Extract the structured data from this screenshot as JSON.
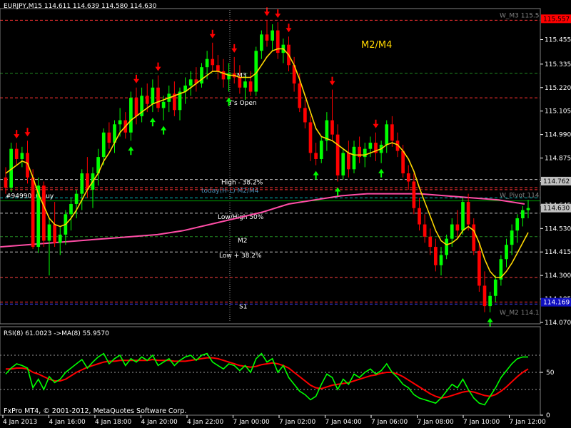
{
  "header": {
    "symbol_line": "EURJPY,M15  114.611 114.639 114.580 114.630",
    "rsi_line": "RSI(8) 61.0023  ->MA(8) 55.9570",
    "copyright": "FxPro MT4, © 2001-2012, MetaQuotes Software Corp."
  },
  "colors": {
    "background": "#000000",
    "bull": "#00ff00",
    "bear": "#ff0000",
    "ma_fast": "#ffd700",
    "ma_slow": "#ff4da6",
    "rsi": "#00ff00",
    "rsi_ma": "#ff0000",
    "axis_text": "#ffffff",
    "grid_dash": "#ff3333",
    "level_green": "#228b22",
    "level_white": "#c0c0c0",
    "current_price_tag": "#c0c0c0",
    "tag_red": "#ff0000",
    "tag_blue": "#1010c0"
  },
  "annotation": "M2/M4",
  "chart_data": [
    {
      "type": "candlestick",
      "title": "EURJPY,M15",
      "ylim": [
        114.07,
        115.6
      ],
      "yticks": [
        "115.455",
        "115.335",
        "115.220",
        "115.105",
        "114.990",
        "114.875",
        "114.760",
        "114.645",
        "114.530",
        "114.415",
        "114.300",
        "114.185",
        "114.070"
      ],
      "xticks": [
        "4 Jan 2013",
        "4 Jan 16:00",
        "4 Jan 18:00",
        "4 Jan 20:00",
        "4 Jan 22:00",
        "7 Jan 00:00",
        "7 Jan 02:00",
        "7 Jan 04:00",
        "7 Jan 06:00",
        "7 Jan 08:00",
        "7 Jan 10:00",
        "7 Jan 12:00"
      ],
      "ohlc": [
        [
          114.78,
          114.83,
          114.7,
          114.73
        ],
        [
          114.73,
          114.95,
          114.71,
          114.92
        ],
        [
          114.92,
          114.95,
          114.84,
          114.87
        ],
        [
          114.87,
          114.93,
          114.83,
          114.9
        ],
        [
          114.9,
          114.96,
          114.75,
          114.78
        ],
        [
          114.78,
          114.82,
          114.43,
          114.44
        ],
        [
          114.44,
          114.78,
          114.41,
          114.74
        ],
        [
          114.74,
          114.76,
          114.44,
          114.47
        ],
        [
          114.47,
          114.58,
          114.3,
          114.55
        ],
        [
          114.55,
          114.66,
          114.44,
          114.46
        ],
        [
          114.46,
          114.54,
          114.4,
          114.5
        ],
        [
          114.5,
          114.62,
          114.45,
          114.6
        ],
        [
          114.6,
          114.68,
          114.52,
          114.65
        ],
        [
          114.65,
          114.72,
          114.58,
          114.7
        ],
        [
          114.7,
          114.82,
          114.62,
          114.8
        ],
        [
          114.8,
          114.88,
          114.68,
          114.72
        ],
        [
          114.72,
          114.83,
          114.63,
          114.8
        ],
        [
          114.8,
          114.92,
          114.74,
          114.88
        ],
        [
          114.88,
          115.02,
          114.84,
          115.0
        ],
        [
          115.0,
          115.05,
          114.92,
          114.95
        ],
        [
          114.95,
          115.06,
          114.9,
          115.04
        ],
        [
          115.04,
          115.12,
          114.98,
          115.06
        ],
        [
          115.06,
          115.1,
          114.97,
          115.0
        ],
        [
          115.0,
          115.2,
          114.96,
          115.17
        ],
        [
          115.17,
          115.22,
          115.04,
          115.08
        ],
        [
          115.08,
          115.22,
          115.05,
          115.18
        ],
        [
          115.18,
          115.24,
          115.1,
          115.14
        ],
        [
          115.14,
          115.26,
          115.1,
          115.22
        ],
        [
          115.22,
          115.28,
          115.1,
          115.12
        ],
        [
          115.12,
          115.18,
          115.06,
          115.15
        ],
        [
          115.15,
          115.23,
          115.1,
          115.19
        ],
        [
          115.19,
          115.25,
          115.08,
          115.11
        ],
        [
          115.11,
          115.22,
          115.06,
          115.2
        ],
        [
          115.2,
          115.27,
          115.14,
          115.23
        ],
        [
          115.23,
          115.3,
          115.18,
          115.26
        ],
        [
          115.26,
          115.32,
          115.2,
          115.24
        ],
        [
          115.24,
          115.34,
          115.22,
          115.32
        ],
        [
          115.32,
          115.4,
          115.26,
          115.36
        ],
        [
          115.36,
          115.44,
          115.3,
          115.33
        ],
        [
          115.33,
          115.38,
          115.26,
          115.3
        ],
        [
          115.3,
          115.36,
          115.22,
          115.26
        ],
        [
          115.26,
          115.34,
          115.2,
          115.29
        ],
        [
          115.29,
          115.37,
          115.24,
          115.27
        ],
        [
          115.27,
          115.33,
          115.19,
          115.22
        ],
        [
          115.22,
          115.28,
          115.16,
          115.25
        ],
        [
          115.25,
          115.3,
          115.18,
          115.2
        ],
        [
          115.2,
          115.42,
          115.18,
          115.4
        ],
        [
          115.4,
          115.5,
          115.36,
          115.48
        ],
        [
          115.48,
          115.55,
          115.42,
          115.45
        ],
        [
          115.45,
          115.53,
          115.4,
          115.5
        ],
        [
          115.5,
          115.54,
          115.36,
          115.39
        ],
        [
          115.39,
          115.46,
          115.34,
          115.43
        ],
        [
          115.43,
          115.47,
          115.3,
          115.33
        ],
        [
          115.33,
          115.37,
          115.2,
          115.24
        ],
        [
          115.24,
          115.29,
          115.1,
          115.12
        ],
        [
          115.12,
          115.16,
          115.02,
          115.05
        ],
        [
          115.05,
          115.08,
          114.86,
          114.9
        ],
        [
          114.9,
          114.95,
          114.84,
          114.87
        ],
        [
          114.87,
          114.98,
          114.85,
          114.96
        ],
        [
          114.96,
          115.1,
          114.91,
          115.06
        ],
        [
          115.06,
          115.21,
          114.96,
          114.99
        ],
        [
          114.99,
          115.04,
          114.76,
          114.79
        ],
        [
          114.79,
          114.92,
          114.77,
          114.9
        ],
        [
          114.9,
          114.96,
          114.78,
          114.82
        ],
        [
          114.82,
          114.96,
          114.8,
          114.93
        ],
        [
          114.93,
          114.98,
          114.85,
          114.88
        ],
        [
          114.88,
          114.95,
          114.83,
          114.92
        ],
        [
          114.92,
          114.98,
          114.88,
          114.95
        ],
        [
          114.95,
          115.0,
          114.86,
          114.9
        ],
        [
          114.9,
          114.96,
          114.85,
          114.94
        ],
        [
          114.94,
          115.06,
          114.9,
          115.04
        ],
        [
          115.04,
          115.08,
          114.93,
          114.96
        ],
        [
          114.96,
          115.0,
          114.88,
          114.91
        ],
        [
          114.91,
          114.94,
          114.78,
          114.8
        ],
        [
          114.8,
          114.84,
          114.72,
          114.76
        ],
        [
          114.76,
          114.8,
          114.6,
          114.63
        ],
        [
          114.63,
          114.68,
          114.52,
          114.55
        ],
        [
          114.55,
          114.6,
          114.46,
          114.49
        ],
        [
          114.49,
          114.53,
          114.4,
          114.44
        ],
        [
          114.44,
          114.48,
          114.32,
          114.35
        ],
        [
          114.35,
          114.44,
          114.3,
          114.4
        ],
        [
          114.4,
          114.5,
          114.38,
          114.48
        ],
        [
          114.48,
          114.58,
          114.44,
          114.55
        ],
        [
          114.55,
          114.62,
          114.48,
          114.52
        ],
        [
          114.52,
          114.68,
          114.5,
          114.66
        ],
        [
          114.66,
          114.7,
          114.52,
          114.55
        ],
        [
          114.55,
          114.58,
          114.4,
          114.42
        ],
        [
          114.42,
          114.46,
          114.22,
          114.25
        ],
        [
          114.25,
          114.32,
          114.12,
          114.15
        ],
        [
          114.15,
          114.22,
          114.12,
          114.2
        ],
        [
          114.2,
          114.3,
          114.17,
          114.28
        ],
        [
          114.28,
          114.4,
          114.25,
          114.38
        ],
        [
          114.38,
          114.48,
          114.34,
          114.45
        ],
        [
          114.45,
          114.55,
          114.4,
          114.52
        ],
        [
          114.52,
          114.6,
          114.46,
          114.58
        ],
        [
          114.58,
          114.64,
          114.54,
          114.62
        ],
        [
          114.62,
          114.67,
          114.58,
          114.63
        ]
      ],
      "series": [
        {
          "name": "",
          "values": [
            114.8,
            114.82,
            114.84,
            114.86,
            114.85,
            114.78,
            114.7,
            114.64,
            114.58,
            114.55,
            114.54,
            114.55,
            114.58,
            114.62,
            114.67,
            114.72,
            114.76,
            114.8,
            114.86,
            114.9,
            114.95,
            115.0,
            115.03,
            115.06,
            115.08,
            115.1,
            115.12,
            115.14,
            115.15,
            115.16,
            115.17,
            115.18,
            115.19,
            115.2,
            115.22,
            115.24,
            115.26,
            115.28,
            115.3,
            115.3,
            115.29,
            115.28,
            115.28,
            115.27,
            115.27,
            115.27,
            115.29,
            115.33,
            115.37,
            115.4,
            115.41,
            115.41,
            115.38,
            115.33,
            115.26,
            115.18,
            115.1,
            115.02,
            114.98,
            114.97,
            114.96,
            114.94,
            114.92,
            114.9,
            114.89,
            114.89,
            114.89,
            114.9,
            114.91,
            114.92,
            114.94,
            114.95,
            114.94,
            114.91,
            114.87,
            114.81,
            114.73,
            114.66,
            114.59,
            114.52,
            114.47,
            114.45,
            114.46,
            114.48,
            114.52,
            114.54,
            114.52,
            114.46,
            114.38,
            114.32,
            114.29,
            114.29,
            114.32,
            114.36,
            114.41,
            114.46,
            114.51
          ]
        },
        {
          "name": "",
          "values": [
            114.44,
            114.45,
            114.46,
            114.47,
            114.48,
            114.49,
            114.5,
            114.52,
            114.55,
            114.58,
            114.61,
            114.65,
            114.67,
            114.69,
            114.7,
            114.7,
            114.7,
            114.69,
            114.68,
            114.67,
            114.65
          ]
        }
      ],
      "levels": [
        {
          "label": "W_M3 115.5",
          "value": 115.55
        },
        {
          "label": "M3",
          "value": 115.29
        },
        {
          "label": "T's Open",
          "value": 115.17
        },
        {
          "label": "High - 38.2%",
          "value": 114.77
        },
        {
          "label": "today(H-L) M2/M4",
          "value": 114.73
        },
        {
          "label": "W_Pivot 114.",
          "value": 114.68
        },
        {
          "label": "#9499016  buy",
          "value": 114.665
        },
        {
          "label": "Low/High 50%",
          "value": 114.605
        },
        {
          "label": "M2",
          "value": 114.49
        },
        {
          "label": "Low + 38.2%",
          "value": 114.415
        },
        {
          "label": "S1",
          "value": 114.17
        },
        {
          "label": "W_M2 114.1",
          "value": 114.16
        }
      ],
      "price_tags": [
        "115.557",
        "114.762",
        "114.630",
        "114.169"
      ]
    },
    {
      "type": "line",
      "title": "RSI(8)",
      "ylim": [
        0,
        100
      ],
      "yticks": [
        "50",
        "0"
      ],
      "series": [
        {
          "name": "RSI(8)",
          "values": [
            48,
            55,
            60,
            58,
            55,
            32,
            42,
            30,
            45,
            38,
            42,
            50,
            55,
            60,
            65,
            55,
            62,
            68,
            72,
            60,
            66,
            70,
            58,
            66,
            62,
            68,
            64,
            70,
            58,
            62,
            66,
            58,
            64,
            68,
            70,
            64,
            70,
            72,
            62,
            58,
            54,
            60,
            58,
            52,
            58,
            50,
            66,
            72,
            62,
            66,
            50,
            58,
            44,
            36,
            28,
            24,
            18,
            22,
            36,
            48,
            44,
            30,
            42,
            36,
            48,
            44,
            50,
            54,
            48,
            52,
            60,
            50,
            44,
            36,
            32,
            24,
            20,
            18,
            16,
            14,
            20,
            28,
            36,
            32,
            42,
            30,
            20,
            14,
            12,
            22,
            32,
            44,
            52,
            60,
            66,
            68,
            68
          ]
        },
        {
          "name": "->MA(8)",
          "values": [
            54,
            54,
            55,
            55,
            54,
            50,
            48,
            45,
            42,
            40,
            40,
            42,
            46,
            50,
            53,
            56,
            58,
            60,
            62,
            63,
            63,
            64,
            64,
            64,
            64,
            64,
            64,
            65,
            64,
            64,
            64,
            63,
            63,
            63,
            64,
            65,
            66,
            67,
            67,
            66,
            64,
            62,
            60,
            58,
            57,
            56,
            57,
            59,
            60,
            61,
            60,
            58,
            55,
            50,
            45,
            40,
            35,
            32,
            31,
            33,
            35,
            36,
            37,
            38,
            40,
            42,
            44,
            46,
            47,
            49,
            50,
            50,
            48,
            45,
            41,
            37,
            33,
            29,
            25,
            22,
            20,
            21,
            23,
            25,
            27,
            28,
            27,
            25,
            23,
            22,
            24,
            28,
            33,
            39,
            45,
            50,
            54
          ]
        }
      ],
      "levels": [
        70,
        50,
        30
      ]
    }
  ]
}
